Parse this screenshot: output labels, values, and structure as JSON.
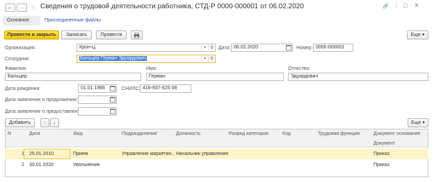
{
  "window": {
    "title": "Сведения о трудовой деятельности работника, СТД-Р 0000-000001 от 06.02.2020",
    "back_glyph": "←",
    "forward_glyph": "→",
    "star_glyph": "☆",
    "link_glyph": "🔗",
    "more_glyph": "⋮",
    "restore_glyph": "□",
    "close_glyph": "×"
  },
  "tabs": [
    {
      "label": "Основное",
      "active": true
    },
    {
      "label": "Присоединенные файлы",
      "active": false
    }
  ],
  "toolbar": {
    "post_close_label": "Провести и закрыть",
    "save_label": "Записать",
    "post_label": "Провести",
    "print_icon": "printer-icon",
    "more_label": "Еще ▾"
  },
  "form": {
    "org_label": "Организация:",
    "org_value": "Крон-Ц",
    "date_label": "Дата:",
    "date_value": "06.02.2020",
    "number_label": "Номер:",
    "number_value": "0000-000001",
    "employee_label": "Сотрудник:",
    "employee_value": "Бальцер Герман Эдуардович",
    "lastname_label": "Фамилия:",
    "lastname_value": "Бальцер",
    "firstname_label": "Имя:",
    "firstname_value": "Герман",
    "patronymic_label": "Отчество:",
    "patronymic_value": "Эдуардович",
    "birthdate_label": "Дата рождения:",
    "birthdate_value": "01.01.1966",
    "snils_label": "СНИЛС:",
    "snils_value": "416-937-625 08",
    "continue_label": "Дата заявление о продолжении:",
    "continue_value": ". .",
    "provide_label": "Дата заявление о предоставлении:",
    "provide_value": ". ."
  },
  "table_toolbar": {
    "add_label": "Добавить",
    "up_glyph": "↑",
    "down_glyph": "↓",
    "more_label": "Еще ▾"
  },
  "table": {
    "columns": [
      "N",
      "Дата",
      "Вид",
      "Подразделение",
      "Должность",
      "Разряд категория",
      "Код",
      "Трудовая функция",
      "Документ основание"
    ],
    "subheader": "Документ",
    "rows": [
      {
        "n": "1",
        "date": "25.01.2010",
        "kind": "Прием",
        "dept": "Управление маркетин...",
        "position": "Начальник управления",
        "grade": "",
        "code": "",
        "function": "",
        "doc": "Приказ"
      },
      {
        "n": "2",
        "date": "30.01.2020",
        "kind": "Увольнение",
        "dept": "",
        "position": "",
        "grade": "",
        "code": "",
        "function": "",
        "doc": "Приказ"
      }
    ]
  },
  "colors": {
    "accent": "#f5c900",
    "selected_row": "#fdf5c8",
    "link": "#2a5ea8",
    "highlight": "#3c7fd7"
  }
}
